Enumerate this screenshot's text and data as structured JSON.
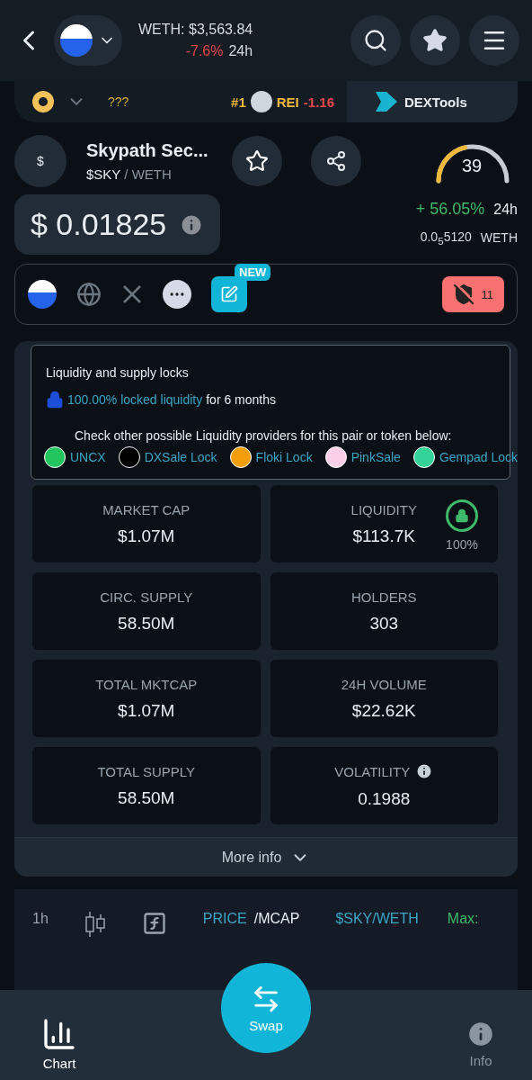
{
  "header": {
    "weth_price": "WETH: $3,563.84",
    "change": "-7.6%",
    "period": "24h"
  },
  "ticker": {
    "label": "???",
    "rank": "#1",
    "symbol": "REI",
    "change": "-1.16",
    "brand": "DEXTools"
  },
  "token": {
    "icon_text": "$",
    "name": "Skypath Sec...",
    "symbol": "$SKY",
    "quote": "/ WETH",
    "favorite": false
  },
  "score": {
    "value": "39",
    "level": 0.39
  },
  "price": {
    "value": "$ 0.01825",
    "change": "+ 56.05%",
    "period": "24h",
    "native": "0.0$_{5}$5120",
    "native_unit": "WETH"
  },
  "links": {
    "badge": "NEW",
    "audit_count": "11"
  },
  "locks": {
    "title": "Liquidity and supply locks",
    "locked": "100.00% locked liquidity",
    "locked_rest": "for 6 months",
    "hint": "Check other possible Liquidity providers for this pair or token below:",
    "providers": [
      {
        "name": "UNCX",
        "color": "#22c55e"
      },
      {
        "name": "DXSale Lock",
        "color": "#000000"
      },
      {
        "name": "Floki Lock",
        "color": "#f59e0b"
      },
      {
        "name": "PinkSale",
        "color": "#fbcfe8"
      },
      {
        "name": "Gempad Lock",
        "color": "#34d399"
      }
    ]
  },
  "stats": [
    {
      "label": "MARKET CAP",
      "value": "$1.07M",
      "kind": "plain"
    },
    {
      "label": "LIQUIDITY",
      "value": "$113.7K",
      "kind": "lock",
      "reading": "100%"
    },
    {
      "label": "CIRC. SUPPLY",
      "value": "58.50M",
      "kind": "plain"
    },
    {
      "label": "HOLDERS",
      "value": "303",
      "kind": "plain"
    },
    {
      "label": "TOTAL MKTCAP",
      "value": "$1.07M",
      "kind": "plain"
    },
    {
      "label": "24H VOLUME",
      "value": "$22.62K",
      "kind": "plain"
    },
    {
      "label": "TOTAL SUPPLY",
      "value": "58.50M",
      "kind": "plain"
    },
    {
      "label": "VOLATILITY",
      "value": "0.1988",
      "kind": "info"
    }
  ],
  "more_info": "More info",
  "chart_toolbar": {
    "interval": "1h",
    "price": "PRICE",
    "mcap": "/MCAP",
    "pair": "$SKY/WETH",
    "max": "Max:"
  },
  "nav": [
    {
      "label": "Chart",
      "kind": "chart",
      "selected": true
    },
    {
      "label": "Swap",
      "kind": "swap",
      "selected": false
    },
    {
      "label": "Info",
      "kind": "info",
      "selected": false
    }
  ]
}
